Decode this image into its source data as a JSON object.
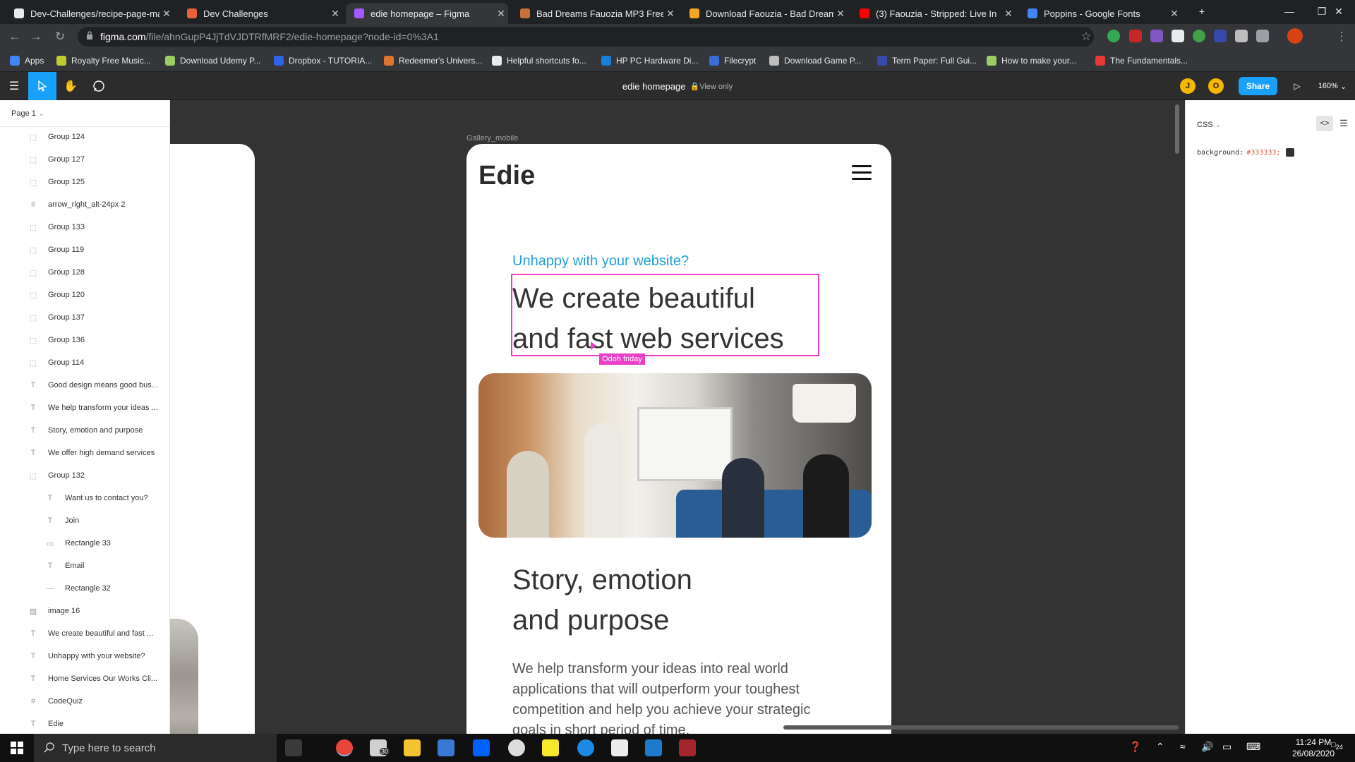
{
  "browser": {
    "tabs": [
      {
        "title": "Dev-Challenges/recipe-page-ma",
        "favicon_color": "#e8eaed",
        "active": false
      },
      {
        "title": "Dev Challenges",
        "favicon_color": "#e8603c",
        "active": false
      },
      {
        "title": "edie homepage – Figma",
        "favicon_color": "#a259ff",
        "active": true
      },
      {
        "title": "Bad Dreams Fauozia MP3 Free D",
        "favicon_color": "#c8703c",
        "active": false
      },
      {
        "title": "Download Faouzia - Bad Dreams",
        "favicon_color": "#f5a623",
        "active": false
      },
      {
        "title": "(3) Faouzia - Stripped: Live In",
        "favicon_color": "#ff0000",
        "active": false
      },
      {
        "title": "Poppins - Google Fonts",
        "favicon_color": "#4285f4",
        "active": false
      }
    ],
    "new_tab": "+",
    "url_host": "figma.com",
    "url_path": "/file/ahnGupP4JjTdVJDTRfMRF2/edie-homepage?node-id=0%3A1",
    "bookmarks": [
      {
        "label": "Apps",
        "color": "#4285f4"
      },
      {
        "label": "Royalty Free Music...",
        "color": "#c0ca33"
      },
      {
        "label": "Download Udemy P...",
        "color": "#9ccc65"
      },
      {
        "label": "Dropbox - TUTORIA...",
        "color": "#2f64e8"
      },
      {
        "label": "Redeemer's Univers...",
        "color": "#e0742c"
      },
      {
        "label": "Helpful shortcuts fo...",
        "color": "#e8eaed"
      },
      {
        "label": "HP PC Hardware Di...",
        "color": "#1a7fd6"
      },
      {
        "label": "Filecrypt",
        "color": "#3b6bd8"
      },
      {
        "label": "Download Game P...",
        "color": "#bdbdbd"
      },
      {
        "label": "Term Paper: Full Gui...",
        "color": "#3949ab"
      },
      {
        "label": "How to make your...",
        "color": "#9ccc65"
      },
      {
        "label": "The Fundamentals...",
        "color": "#e53935"
      }
    ]
  },
  "figma": {
    "doc_title": "edie homepage",
    "view_mode": "View only",
    "avatars": [
      "J",
      "O"
    ],
    "share_label": "Share",
    "zoom": "160%",
    "page_selector": "Page 1",
    "layers": [
      {
        "name": "Group 124",
        "kind": "group",
        "indent": 1
      },
      {
        "name": "Group 127",
        "kind": "group",
        "indent": 1
      },
      {
        "name": "Group 125",
        "kind": "group",
        "indent": 1
      },
      {
        "name": "arrow_right_alt-24px 2",
        "kind": "frame",
        "indent": 1
      },
      {
        "name": "Group 133",
        "kind": "group",
        "indent": 1
      },
      {
        "name": "Group 119",
        "kind": "group",
        "indent": 1
      },
      {
        "name": "Group 128",
        "kind": "group",
        "indent": 1
      },
      {
        "name": "Group 120",
        "kind": "group",
        "indent": 1
      },
      {
        "name": "Group 137",
        "kind": "group",
        "indent": 1
      },
      {
        "name": "Group 136",
        "kind": "group",
        "indent": 1
      },
      {
        "name": "Group 114",
        "kind": "group",
        "indent": 1
      },
      {
        "name": "Good design means good bus...",
        "kind": "text",
        "indent": 1
      },
      {
        "name": "We help transform your ideas ...",
        "kind": "text",
        "indent": 1
      },
      {
        "name": "Story, emotion and purpose",
        "kind": "text",
        "indent": 1
      },
      {
        "name": "We offer high demand services",
        "kind": "text",
        "indent": 1
      },
      {
        "name": "Group 132",
        "kind": "group",
        "indent": 1
      },
      {
        "name": "Want us to contact you?",
        "kind": "text",
        "indent": 2
      },
      {
        "name": "Join",
        "kind": "text",
        "indent": 2
      },
      {
        "name": "Rectangle 33",
        "kind": "rect",
        "indent": 2
      },
      {
        "name": "Email",
        "kind": "text",
        "indent": 2
      },
      {
        "name": "Rectangle 32",
        "kind": "line",
        "indent": 2
      },
      {
        "name": "image 16",
        "kind": "image",
        "indent": 1
      },
      {
        "name": "We create beautiful and fast ...",
        "kind": "text",
        "indent": 1
      },
      {
        "name": "Unhappy with your website?",
        "kind": "text",
        "indent": 1
      },
      {
        "name": "Home Services Our Works Cli...",
        "kind": "text",
        "indent": 1
      },
      {
        "name": "CodeQuiz",
        "kind": "frame",
        "indent": 1
      },
      {
        "name": "Edie",
        "kind": "text",
        "indent": 1
      }
    ],
    "frame_label": "Gallery_mobile",
    "design": {
      "logo": "Edie",
      "tagline": "Unhappy with your website?",
      "headline_line1": "We create beautiful",
      "headline_line2": "and fast web services",
      "collaborator_tooltip": "Odoh friday",
      "story_line1": "Story, emotion",
      "story_line2": "and purpose",
      "story_body": "We help transform your ideas into real world applications that will outperform your toughest competition and help you achieve your strategic goals in short period of time."
    },
    "inspect": {
      "mode": "CSS",
      "property": "background:",
      "value": "#333333;",
      "swatch_color": "#333333"
    },
    "help": "?"
  },
  "taskbar": {
    "search_placeholder": "Type here to search",
    "mail_badge": "30",
    "time": "11:24 PM",
    "date": "26/08/2020",
    "notifications": "24"
  }
}
